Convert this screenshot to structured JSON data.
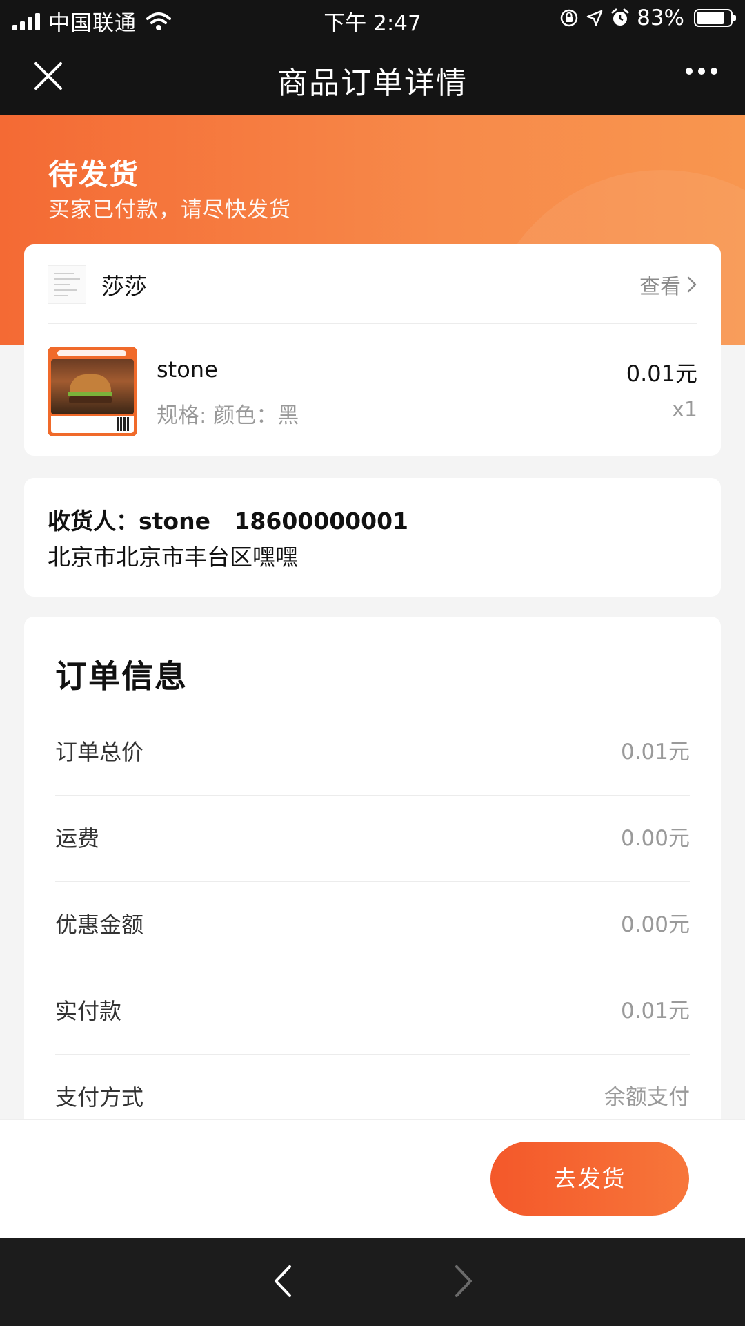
{
  "status_bar": {
    "carrier": "中国联通",
    "time": "下午 2:47",
    "battery_text": "83%",
    "battery_level": 0.83,
    "icons": [
      "signal-icon",
      "wifi-icon",
      "orientation-lock-icon",
      "location-icon",
      "alarm-icon",
      "battery-icon"
    ]
  },
  "nav": {
    "title": "商品订单详情",
    "close_icon": "close-icon",
    "more_icon": "more-icon"
  },
  "order_status": {
    "title": "待发货",
    "subtitle": "买家已付款，请尽快发货"
  },
  "shop": {
    "name": "莎莎",
    "view_label": "查看",
    "view_icon": "chevron-right-icon"
  },
  "product": {
    "name": "stone",
    "spec": "规格: 颜色：黑",
    "price": "0.01元",
    "quantity": "x1"
  },
  "address": {
    "receiver_line": "收货人：stone   18600000001",
    "address_line": "北京市北京市丰台区嘿嘿"
  },
  "order_info": {
    "title": "订单信息",
    "rows": [
      {
        "label": "订单总价",
        "value": "0.01元"
      },
      {
        "label": "运费",
        "value": "0.00元"
      },
      {
        "label": "优惠金额",
        "value": "0.00元"
      },
      {
        "label": "实付款",
        "value": "0.01元"
      },
      {
        "label": "支付方式",
        "value": "余额支付"
      }
    ]
  },
  "actions": {
    "ship_label": "去发货"
  },
  "browser": {
    "back_icon": "back-arrow-icon",
    "forward_icon": "forward-arrow-icon"
  },
  "colors": {
    "accent": "#f46a34",
    "bar_dark": "#141414"
  }
}
